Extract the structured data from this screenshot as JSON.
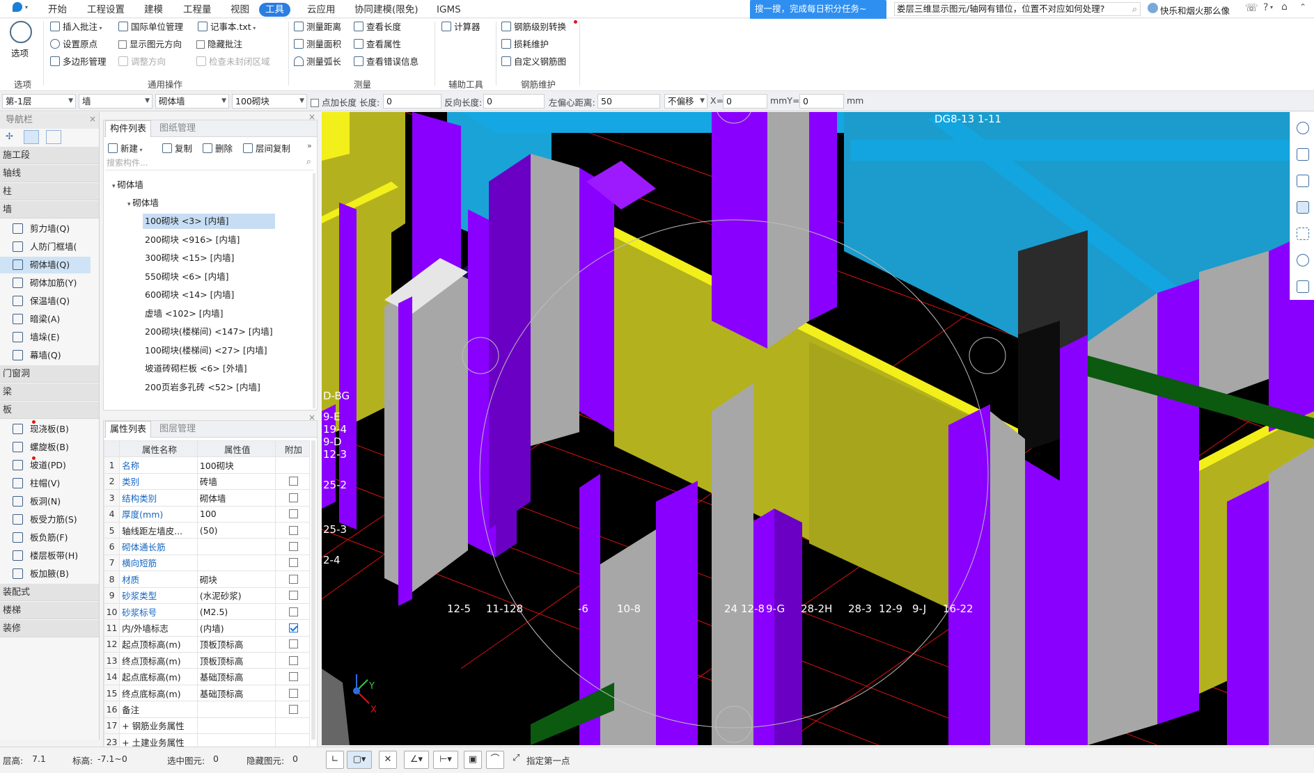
{
  "menu": {
    "items": [
      "开始",
      "工程设置",
      "建模",
      "工程量",
      "视图",
      "工具",
      "云应用",
      "协同建模(限免)",
      "IGMS"
    ],
    "active": "工具",
    "search_promo": "搜一搜，完成每日积分任务~",
    "query_text": "娄层三维显示图元/轴网有错位，位置不对应如何处理?",
    "user": "快乐和烟火那么像",
    "help": "?"
  },
  "ribbon": {
    "options_label": "选项",
    "options_group": "选项",
    "general_group": "通用操作",
    "measure_group": "测量",
    "aux_group": "辅助工具",
    "rebar_group": "钢筋维护",
    "insert_note": "插入批注",
    "set_origin": "设置原点",
    "polygon_mgmt": "多边形管理",
    "intl_unit": "国际单位管理",
    "show_direction": "显示图元方向",
    "adjust_direction": "调整方向",
    "notepad": "记事本.txt",
    "hide_note": "隐藏批注",
    "check_unclosed": "检查未封闭区域",
    "measure_distance": "测量距离",
    "measure_area": "测量面积",
    "measure_arc": "测量弧长",
    "view_length": "查看长度",
    "view_props": "查看属性",
    "view_errors": "查看错误信息",
    "calculator": "计算器",
    "rebar_grade": "钢筋级别转换",
    "loss_maint": "损耗维护",
    "custom_rebar": "自定义钢筋图"
  },
  "optbar": {
    "floor": "第-1层",
    "category": "墙",
    "type": "砌体墙",
    "member": "100砌块",
    "add_length_label": "点加长度",
    "length_label": "长度:",
    "length_value": "0",
    "reverse_label": "反向长度:",
    "reverse_value": "0",
    "left_offset_label": "左偏心距离:",
    "left_offset_value": "50",
    "offset_mode": "不偏移",
    "x_label": "X=",
    "x_value": "0",
    "mm1": "mmY=",
    "y_value": "0",
    "mm2": "mm"
  },
  "nav": {
    "title": "导航栏",
    "sections": {
      "construction": "施工段",
      "axis": "轴线",
      "column": "柱",
      "wall": "墙",
      "door_window": "门窗洞",
      "beam": "梁",
      "slab": "板",
      "prefab": "装配式",
      "stairs": "楼梯",
      "decoration": "装修"
    },
    "wall_items": [
      "剪力墙(Q)",
      "人防门框墙(",
      "砌体墙(Q)",
      "砌体加筋(Y)",
      "保温墙(Q)",
      "暗梁(A)",
      "墙垛(E)",
      "幕墙(Q)"
    ],
    "slab_items": [
      "现浇板(B)",
      "螺旋板(B)",
      "坡道(PD)",
      "柱帽(V)",
      "板洞(N)",
      "板受力筋(S)",
      "板负筋(F)",
      "楼层板带(H)",
      "板加腋(B)"
    ]
  },
  "components": {
    "tab_list": "构件列表",
    "tab_drawing": "图纸管理",
    "btn_new": "新建",
    "btn_copy": "复制",
    "btn_delete": "删除",
    "btn_floor_copy": "层间复制",
    "search_placeholder": "搜索构件...",
    "root": "砌体墙",
    "sub": "砌体墙",
    "items": [
      "100砌块 <3> [内墙]",
      "200砌块 <916> [内墙]",
      "300砌块 <15> [内墙]",
      "550砌块 <6> [内墙]",
      "600砌块 <14> [内墙]",
      "虚墙 <102> [内墙]",
      "200砌块(楼梯间) <147> [内墙]",
      "100砌块(楼梯间) <27> [内墙]",
      "坡道砖砌栏板 <6> [外墙]",
      "200页岩多孔砖 <52> [内墙]"
    ]
  },
  "properties": {
    "tab_props": "属性列表",
    "tab_layers": "图层管理",
    "col_name": "属性名称",
    "col_value": "属性值",
    "col_extra": "附加",
    "rows": [
      {
        "no": "1",
        "name": "名称",
        "value": "100砌块",
        "blue": true,
        "check": "none"
      },
      {
        "no": "2",
        "name": "类别",
        "value": "砖墙",
        "blue": true,
        "check": "off"
      },
      {
        "no": "3",
        "name": "结构类别",
        "value": "砌体墙",
        "blue": true,
        "check": "off"
      },
      {
        "no": "4",
        "name": "厚度(mm)",
        "value": "100",
        "blue": true,
        "check": "off"
      },
      {
        "no": "5",
        "name": "轴线距左墙皮...",
        "value": "(50)",
        "blue": false,
        "check": "off"
      },
      {
        "no": "6",
        "name": "砌体通长筋",
        "value": "",
        "blue": true,
        "check": "off"
      },
      {
        "no": "7",
        "name": "横向短筋",
        "value": "",
        "blue": true,
        "check": "off"
      },
      {
        "no": "8",
        "name": "材质",
        "value": "砌块",
        "blue": true,
        "check": "off"
      },
      {
        "no": "9",
        "name": "砂浆类型",
        "value": "(水泥砂浆)",
        "blue": true,
        "check": "off"
      },
      {
        "no": "10",
        "name": "砂浆标号",
        "value": "(M2.5)",
        "blue": true,
        "check": "off"
      },
      {
        "no": "11",
        "name": "内/外墙标志",
        "value": "(内墙)",
        "blue": false,
        "check": "on"
      },
      {
        "no": "12",
        "name": "起点顶标高(m)",
        "value": "顶板顶标高",
        "blue": false,
        "check": "off"
      },
      {
        "no": "13",
        "name": "终点顶标高(m)",
        "value": "顶板顶标高",
        "blue": false,
        "check": "off"
      },
      {
        "no": "14",
        "name": "起点底标高(m)",
        "value": "基础顶标高",
        "blue": false,
        "check": "off"
      },
      {
        "no": "15",
        "name": "终点底标高(m)",
        "value": "基础顶标高",
        "blue": false,
        "check": "off"
      },
      {
        "no": "16",
        "name": "备注",
        "value": "",
        "blue": false,
        "check": "off"
      },
      {
        "no": "17",
        "name": "+ 钢筋业务属性",
        "value": "",
        "blue": false,
        "check": "none"
      },
      {
        "no": "23",
        "name": "+ 土建业务属性",
        "value": "",
        "blue": false,
        "check": "none"
      }
    ]
  },
  "viewport": {
    "axis_labels": [
      "D-BG",
      "9-E",
      "19-4",
      "9-D",
      "12-3",
      "25-2",
      "25-3",
      "2-4",
      "12-5",
      "11-128",
      "-6",
      "10-8",
      "24",
      "12-8",
      "9-G",
      "28-2H",
      "28-3",
      "12-9",
      "9-J",
      "16-22",
      "DG8-13",
      "1-11"
    ],
    "axis_x": "X",
    "axis_y": "Y"
  },
  "status": {
    "floor_height_label": "层高:",
    "floor_height": "7.1",
    "elevation_label": "标高:",
    "elevation": "-7.1~0",
    "selected_label": "选中图元:",
    "selected": "0",
    "hidden_label": "隐藏图元:",
    "hidden": "0",
    "hint": "指定第一点"
  },
  "colors": {
    "purple": "#8a00ff",
    "yellow": "#b3b21e",
    "cyan": "#1aa3d6",
    "gray": "#a7a7a7",
    "green": "#0b5a10",
    "accent": "#2a7de1"
  }
}
